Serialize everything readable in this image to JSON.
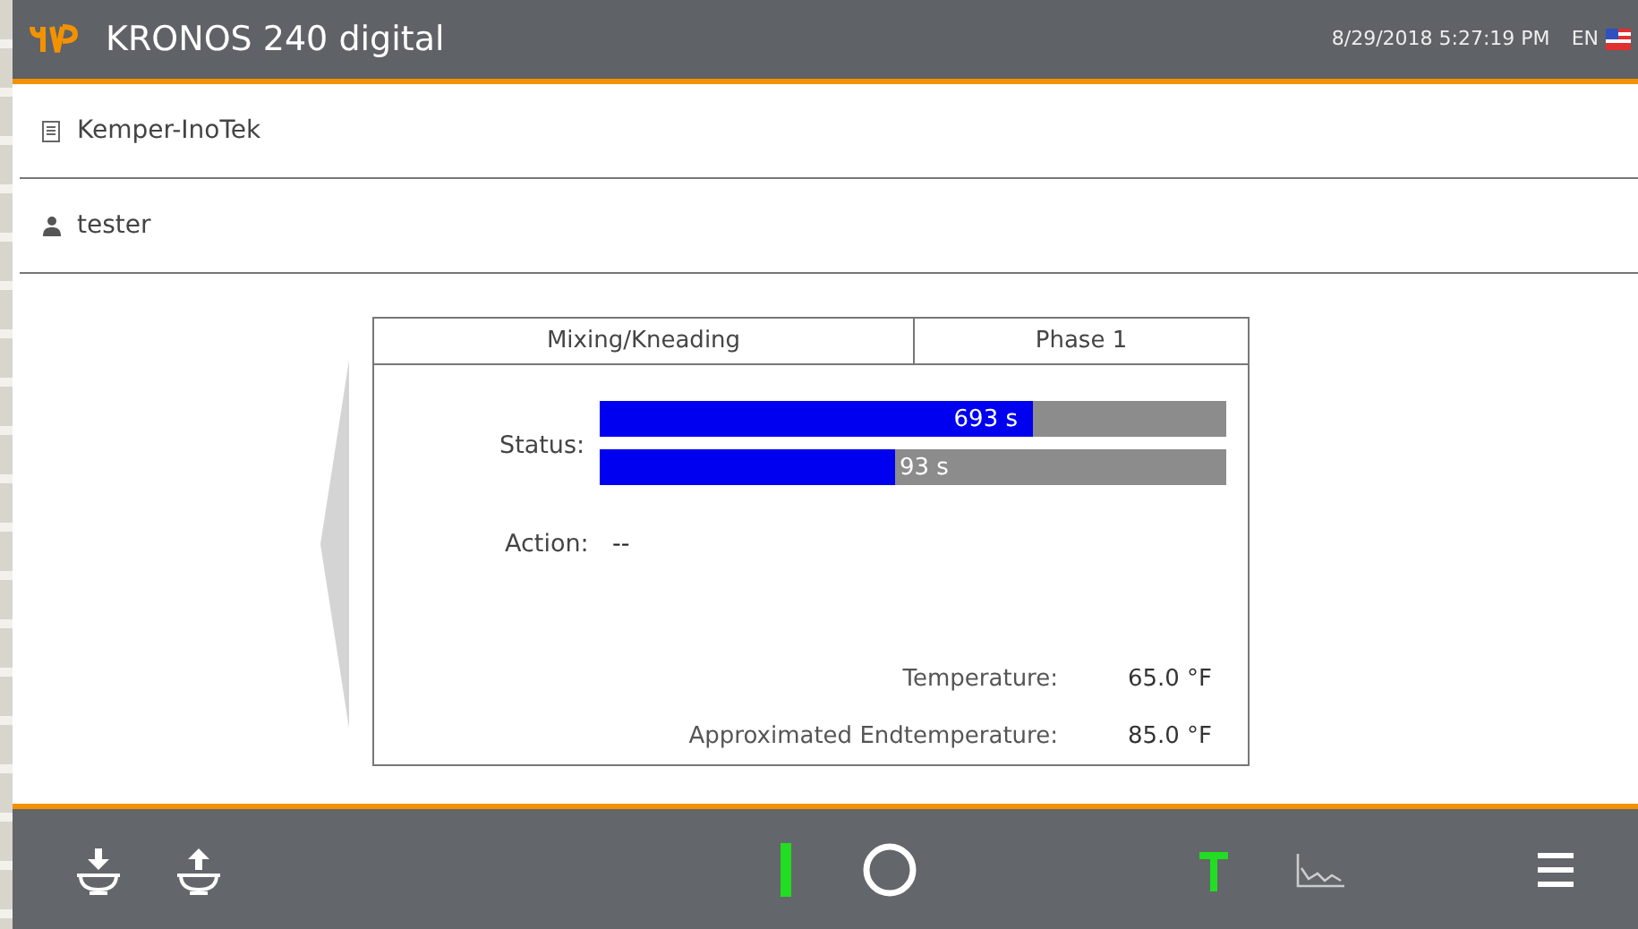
{
  "header": {
    "title": "KRONOS 240 digital",
    "datetime": "8/29/2018 5:27:19 PM",
    "language": "EN"
  },
  "info_rows": [
    {
      "kind": "document",
      "text": "Kemper-InoTek"
    },
    {
      "kind": "user",
      "text": "tester"
    }
  ],
  "program": {
    "name": "Mixing/Kneading",
    "phase": "Phase 1",
    "status_label": "Status:",
    "bars": [
      {
        "level": 0.69,
        "reading": "693 s"
      },
      {
        "level": 0.47,
        "reading": "93 s"
      }
    ],
    "action_label": "Action:",
    "action_value": "--",
    "readings": [
      {
        "label": "Temperature:",
        "value": "65.0 °F"
      },
      {
        "label": "Approximated Endtemperature:",
        "value": "85.0 °F"
      }
    ]
  },
  "footer_buttons": [
    {
      "kind": "bowl-down",
      "active": false
    },
    {
      "kind": "bowl-up",
      "active": false
    },
    {
      "kind": "start",
      "active": true
    },
    {
      "kind": "stop",
      "active": false
    },
    {
      "kind": "tool",
      "active": true
    },
    {
      "kind": "chart",
      "active": false
    },
    {
      "kind": "menu",
      "active": false
    }
  ]
}
